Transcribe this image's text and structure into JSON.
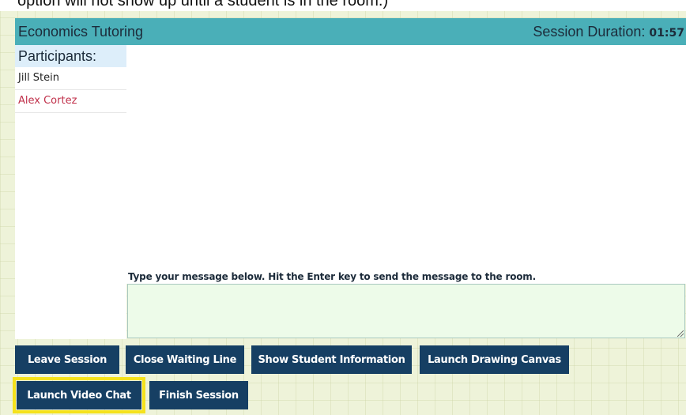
{
  "caption": "option will not show up until a student is in the room.)",
  "header": {
    "title": "Economics Tutoring",
    "duration_label": "Session Duration:",
    "duration_value": "01:57"
  },
  "participants": {
    "heading": "Participants:",
    "list": [
      {
        "name": "Jill Stein",
        "color": "#222222"
      },
      {
        "name": "Alex Cortez",
        "color": "#c0304a"
      }
    ]
  },
  "chat": {
    "hint": "Type your message below. Hit the Enter key to send the message to the room.",
    "message": ""
  },
  "buttons": {
    "leave_session": "Leave Session",
    "close_waiting_line": "Close Waiting Line",
    "show_student_info": "Show Student Information",
    "launch_drawing_canvas": "Launch Drawing Canvas",
    "launch_video_chat": "Launch Video Chat",
    "finish_session": "Finish Session"
  },
  "colors": {
    "header_bg": "#4aafb8",
    "button_bg": "#163f63",
    "highlight": "#f5e21c"
  }
}
